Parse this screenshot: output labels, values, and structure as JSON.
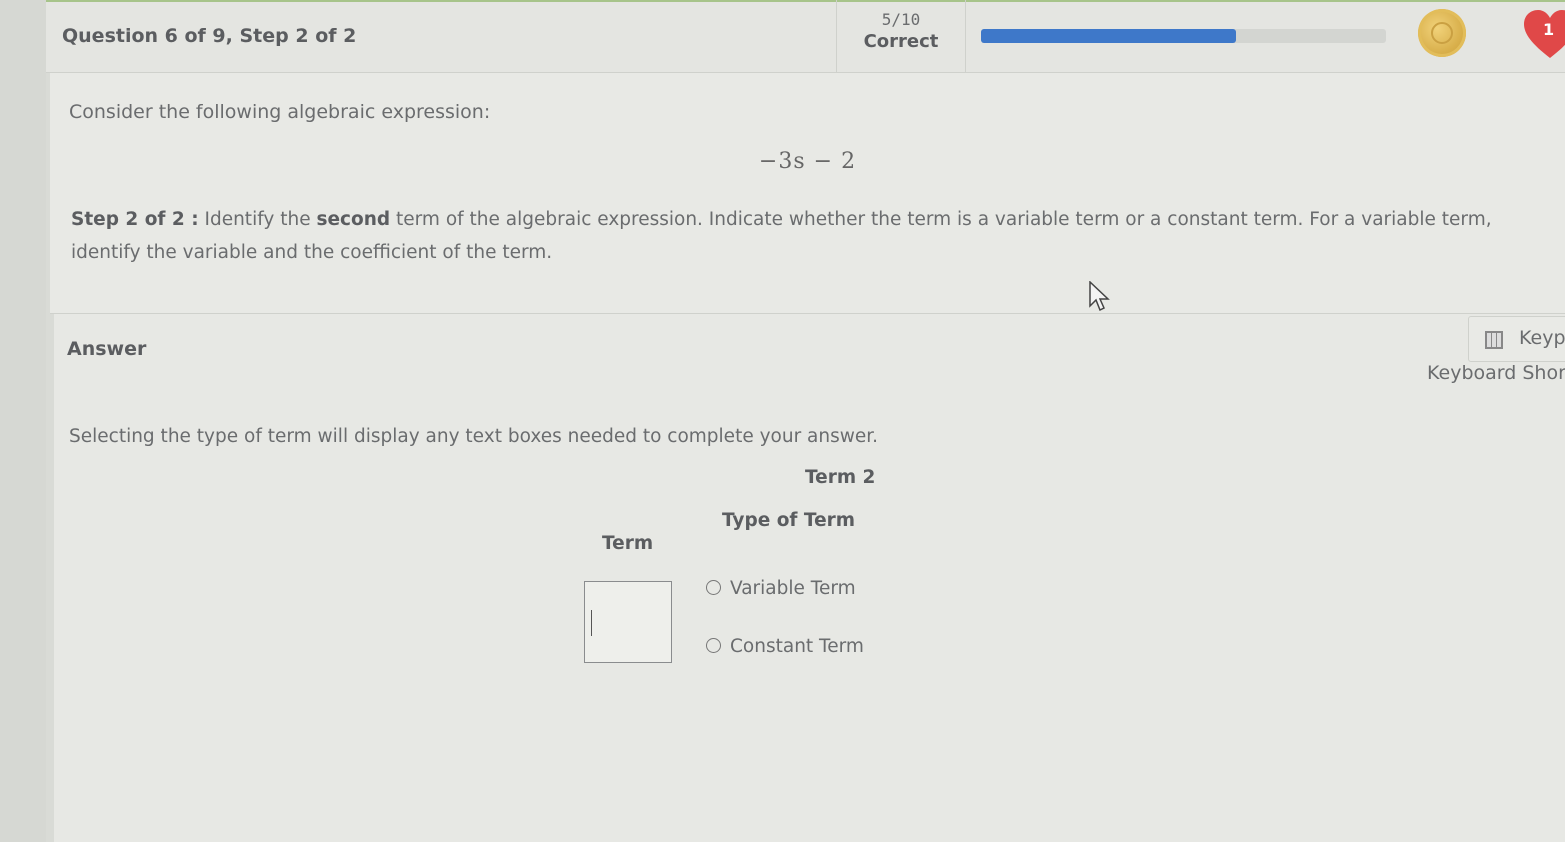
{
  "header": {
    "question_label": "Question 6 of 9, Step 2 of 2",
    "score_fraction": "5/10",
    "score_label": "Correct",
    "progress_fraction": 0.63,
    "hearts_count": "1"
  },
  "question": {
    "intro": "Consider the following algebraic expression:",
    "expression": "−3s − 2",
    "step_prefix": "Step 2 of 2 :",
    "step_text_before_bold": " Identify the ",
    "step_bold_word": "second",
    "step_text_after_bold": " term of the algebraic expression. Indicate whether the term is a variable term or a constant term. For a variable term, identify the variable and the coefficient of the term."
  },
  "answer": {
    "label": "Answer",
    "keypad_label": "Keyp",
    "keyboard_shortcuts_label": "Keyboard Short",
    "instruction": "Selecting the type of term will display any text boxes needed to complete your answer.",
    "term_heading": "Term 2",
    "type_of_term_heading": "Type of Term",
    "term_column_label": "Term",
    "term_input_value": "",
    "options": [
      "Variable Term",
      "Constant Term"
    ]
  },
  "colors": {
    "progress_fill": "#3e78c9",
    "heart": "#e04848",
    "coin": "#d9b04c"
  },
  "icons": [
    "coin-icon",
    "heart-icon",
    "calculator-icon",
    "mouse-pointer-icon"
  ]
}
